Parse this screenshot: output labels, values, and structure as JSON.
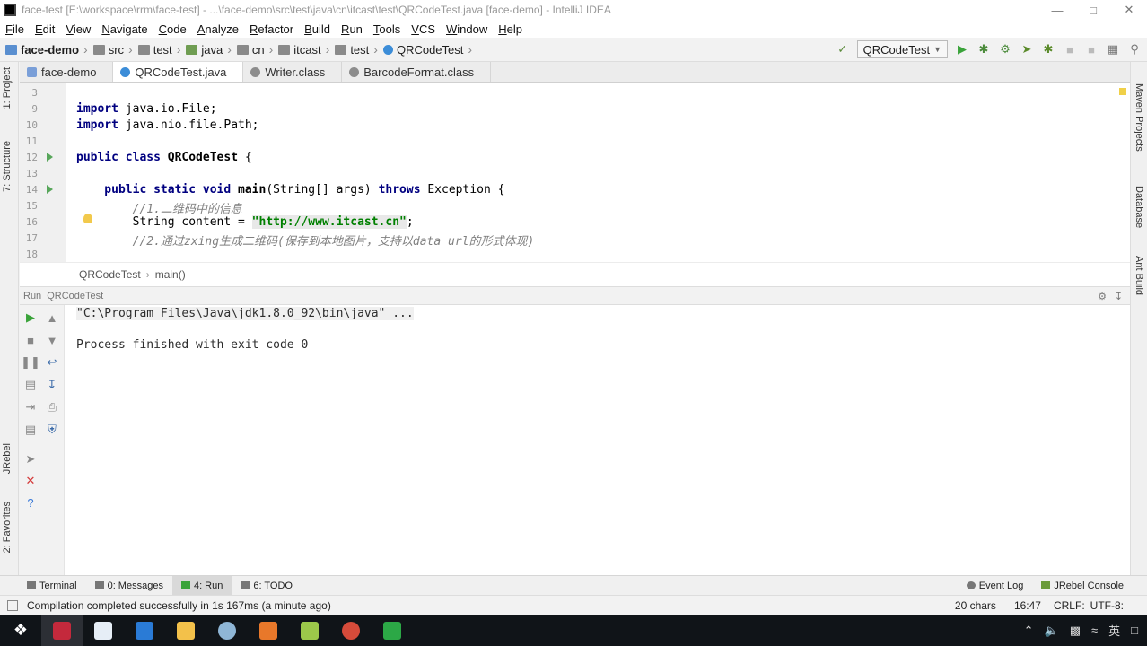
{
  "window": {
    "title": "face-test [E:\\workspace\\rrm\\face-test] - ...\\face-demo\\src\\test\\java\\cn\\itcast\\test\\QRCodeTest.java [face-demo] - IntelliJ IDEA"
  },
  "menu": [
    "File",
    "Edit",
    "View",
    "Navigate",
    "Code",
    "Analyze",
    "Refactor",
    "Build",
    "Run",
    "Tools",
    "VCS",
    "Window",
    "Help"
  ],
  "breadcrumb_nav": [
    "face-demo",
    "src",
    "test",
    "java",
    "cn",
    "itcast",
    "test",
    "QRCodeTest"
  ],
  "run_config": "QRCodeTest",
  "left_tabs": {
    "project": "1: Project",
    "structure": "7: Structure",
    "jrebel": "JRebel",
    "favorites": "2: Favorites"
  },
  "right_tabs": {
    "maven": "Maven Projects",
    "database": "Database",
    "ant": "Ant Build"
  },
  "tabs": [
    {
      "label": "face-demo",
      "icon": "module-icon"
    },
    {
      "label": "QRCodeTest.java",
      "icon": "class-icon"
    },
    {
      "label": "Writer.class",
      "icon": "class-file-icon"
    },
    {
      "label": "BarcodeFormat.class",
      "icon": "class-file-icon"
    }
  ],
  "editor": {
    "lines": [
      {
        "num": "3",
        "html": ""
      },
      {
        "num": "9",
        "kw": "import",
        "rest": " java.io.File;"
      },
      {
        "num": "10",
        "kw": "import",
        "rest": " java.nio.file.Path;"
      },
      {
        "num": "11"
      },
      {
        "num": "12"
      },
      {
        "num": "13"
      },
      {
        "num": "14"
      },
      {
        "num": "15"
      },
      {
        "num": "16"
      },
      {
        "num": "17"
      },
      {
        "num": "18"
      }
    ],
    "line12_a": "public class ",
    "line12_b": "QRCodeTest",
    "line12_c": " {",
    "line14_a": "    public static void ",
    "line14_b": "main",
    "line14_c": "(String[] args) ",
    "line14_d": "throws",
    "line14_e": " Exception {",
    "line15": "        //1.二维码中的信息",
    "line16_a": "        String content = ",
    "line16_b": "\"http://www.itcast.cn\"",
    "line16_c": ";",
    "line17": "        //2.通过zxing生成二维码(保存到本地图片，支持以data url的形式体现)"
  },
  "code_breadcrumb": [
    "QRCodeTest",
    "main()"
  ],
  "run_panel": {
    "label": "Run",
    "config": "QRCodeTest"
  },
  "console": {
    "line1": "\"C:\\Program Files\\Java\\jdk1.8.0_92\\bin\\java\" ...",
    "line2": "Process finished with exit code 0"
  },
  "bottom_tabs": [
    {
      "label": "Terminal"
    },
    {
      "label": "0: Messages"
    },
    {
      "label": "4: Run",
      "active": true
    },
    {
      "label": "6: TODO"
    }
  ],
  "bottom_right": {
    "event_log": "Event Log",
    "jrebel_console": "JRebel Console"
  },
  "status": {
    "message": "Compilation completed successfully in 1s 167ms (a minute ago)",
    "chars": "20 chars",
    "position": "16:47",
    "line_sep": "CRLF",
    "encoding": "UTF-8"
  },
  "taskbar": {
    "ime": "英"
  },
  "colors": {
    "keyword": "#000080",
    "string": "#008000",
    "comment": "#808080",
    "run_green": "#57a65a"
  }
}
